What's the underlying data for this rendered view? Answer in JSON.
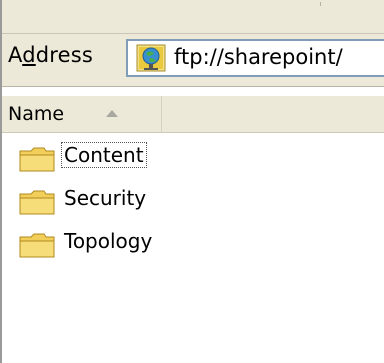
{
  "address_bar": {
    "label": "Address",
    "access_key": "d",
    "value": "ftp://sharepoint/",
    "icon": "ftp-globe-icon"
  },
  "column_header": {
    "name_label": "Name",
    "sort": "ascending"
  },
  "files": [
    {
      "name": "Content",
      "icon": "folder-icon",
      "focused": true
    },
    {
      "name": "Security",
      "icon": "folder-icon",
      "focused": false
    },
    {
      "name": "Topology",
      "icon": "folder-icon",
      "focused": false
    }
  ],
  "colors": {
    "chrome": "#ece9d8",
    "field_border": "#7f9db9",
    "folder": "#f2cf5b"
  }
}
